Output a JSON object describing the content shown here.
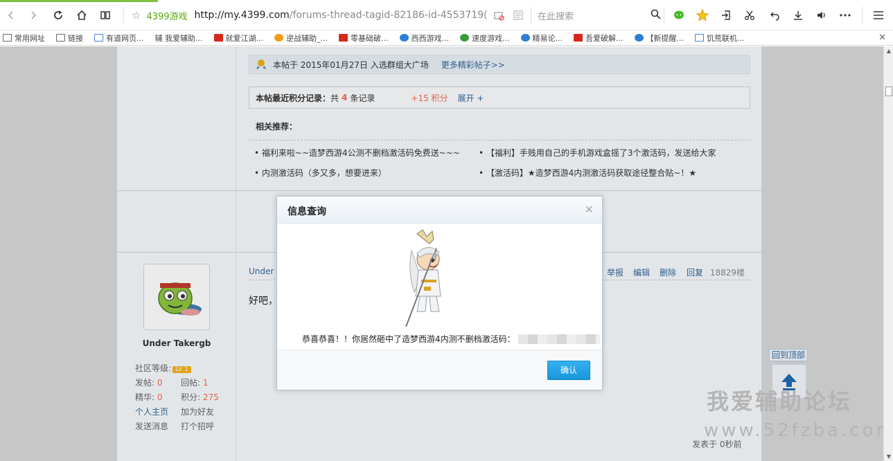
{
  "browser": {
    "site_name": "4399游戏",
    "url_dark": "http://my.4399.com",
    "url_light": "/forums-thread-tagid-82186-id-4553719(",
    "search_placeholder": "在此搜索"
  },
  "bookmarks": [
    {
      "label": "常用网址",
      "icon": "folder-icon"
    },
    {
      "label": "链接",
      "icon": "folder-icon"
    },
    {
      "label": "有道网页...",
      "icon": "page-icon"
    },
    {
      "label": "辅 我爱辅助...",
      "icon": "text-icon"
    },
    {
      "label": "就爱江湖...",
      "icon": "grid-icon"
    },
    {
      "label": "逆战辅助_...",
      "icon": "swirl-icon"
    },
    {
      "label": "零基础破...",
      "icon": "grid-icon"
    },
    {
      "label": "西西游戏...",
      "icon": "globe-icon"
    },
    {
      "label": "速度游戏...",
      "icon": "leaf-icon"
    },
    {
      "label": "精易论...",
      "icon": "eye-icon"
    },
    {
      "label": "吾爱破解...",
      "icon": "grid-icon"
    },
    {
      "label": "【新提醒...",
      "icon": "globe-icon"
    },
    {
      "label": "饥荒联机...",
      "icon": "page-icon"
    }
  ],
  "thread": {
    "featured_text": "本帖于 2015年01月27日 入选群组大广场",
    "more_link": "更多精彩帖子>>",
    "score_label": "本帖最近积分记录：",
    "score_total_prefix": "共",
    "score_count": "4",
    "score_suffix": "条记录",
    "score_points": "+15 积分",
    "expand": "展开 +",
    "related_title": "相关推荐：",
    "related": [
      "• 福利来啦~~造梦西游4公测不删档激活码免费送~~~",
      "• 【福利】手贱用自己的手机游戏盒摇了3个激活码，发送给大家",
      "• 内测激活码（多又多，想要进来）",
      "• 【激活码】★造梦西游4内测激活码获取途径整合贴~！★"
    ]
  },
  "post": {
    "author_partial": "Under T",
    "body_partial": "好吧，",
    "actions": [
      "举报",
      "编辑",
      "删除",
      "回复"
    ],
    "floor": "18829楼",
    "time": "发表于  0秒前"
  },
  "user": {
    "name": "Under Takergb",
    "level_label": "社区等级:",
    "level_badge": "LV 1",
    "posts_label": "发帖:",
    "posts": "0",
    "replies_label": "回帖:",
    "replies": "1",
    "essence_label": "精华:",
    "essence": "0",
    "score_label": "积分:",
    "score": "275",
    "home": "个人主页",
    "add_friend": "加为好友",
    "message": "发送消息",
    "greet": "打个招呼"
  },
  "back_to_top": "回到顶部",
  "watermark": {
    "title": "我爱辅助论坛",
    "url": "www.52fzba.com"
  },
  "dialog": {
    "title": "信息查询",
    "message": "恭喜恭喜！！你居然砸中了造梦西游4内测不删档激活码：",
    "confirm": "确认"
  }
}
